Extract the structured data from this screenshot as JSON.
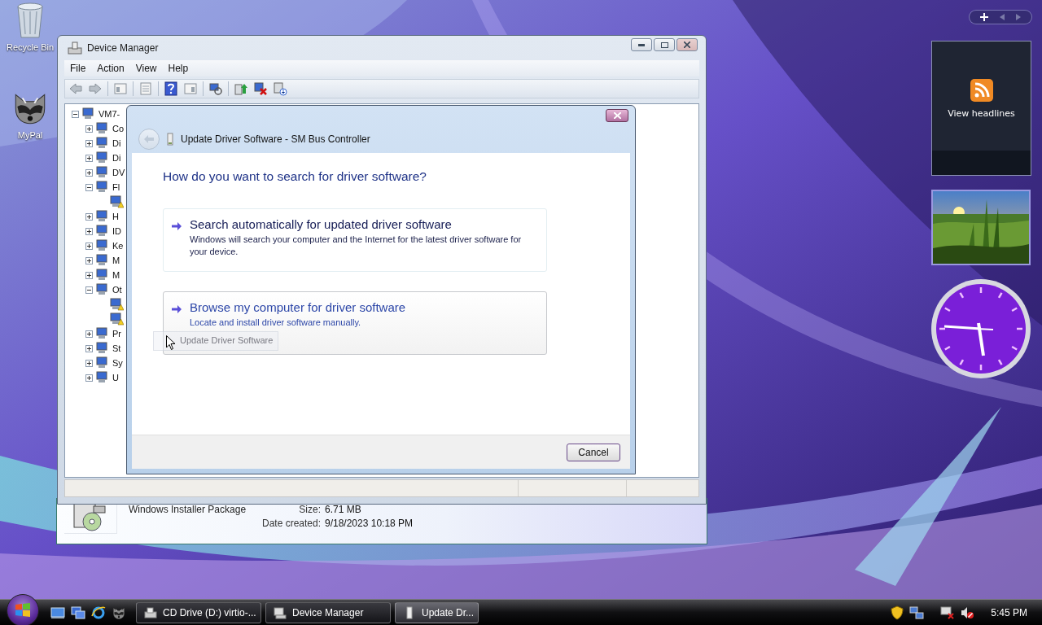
{
  "desktop_icons": [
    {
      "kind": "recycle_bin",
      "label": "Recycle Bin"
    },
    {
      "kind": "mypal",
      "label": "MyPal"
    }
  ],
  "gadgets": {
    "feed": {
      "label": "View headlines"
    }
  },
  "device_manager": {
    "title": "Device Manager",
    "menu": [
      "File",
      "Action",
      "View",
      "Help"
    ],
    "tree": {
      "label": "VM7-",
      "expanded": true,
      "warning": false,
      "children": [
        {
          "label": "Co",
          "expanded": false,
          "warning": false
        },
        {
          "label": "Di",
          "expanded": false,
          "warning": false
        },
        {
          "label": "Di",
          "expanded": false,
          "warning": false
        },
        {
          "label": "DV",
          "expanded": false,
          "warning": false
        },
        {
          "label": "Fl",
          "expanded": true,
          "warning": false,
          "children": [
            {
              "warning": true
            }
          ]
        },
        {
          "label": "H",
          "expanded": false,
          "warning": false
        },
        {
          "label": "ID",
          "expanded": false,
          "warning": false
        },
        {
          "label": "Ke",
          "expanded": false,
          "warning": false
        },
        {
          "label": "M",
          "expanded": false,
          "warning": false
        },
        {
          "label": "M",
          "expanded": false,
          "warning": false
        },
        {
          "label": "Ot",
          "expanded": true,
          "warning": false,
          "children": [
            {
              "warning": true
            },
            {
              "warning": true
            }
          ]
        },
        {
          "label": "Pr",
          "expanded": false,
          "warning": false
        },
        {
          "label": "St",
          "expanded": false,
          "warning": false
        },
        {
          "label": "Sy",
          "expanded": false,
          "warning": false
        },
        {
          "label": "U",
          "expanded": false,
          "warning": false
        }
      ]
    }
  },
  "explorer_details": {
    "file_type": "Windows Installer Package",
    "fields": [
      {
        "label": "Size:",
        "value": "6.71 MB"
      },
      {
        "label": "Date created:",
        "value": "9/18/2023 10:18 PM"
      }
    ]
  },
  "dialog": {
    "title": "Update Driver Software - SM Bus Controller",
    "heading": "How do you want to search for driver software?",
    "options": [
      {
        "title": "Search automatically for updated driver software",
        "description": "Windows will search your computer and the Internet for the latest driver software for your device.",
        "hovered": false
      },
      {
        "title": "Browse my computer for driver software",
        "description": "Locate and install driver software manually.",
        "hovered": true
      }
    ],
    "buttons": [
      "Cancel"
    ],
    "drag_label": "Update Driver Software"
  },
  "taskbar": {
    "tasks": [
      {
        "label": "CD Drive (D:) virtio-...",
        "selected": false
      },
      {
        "label": "Device Manager",
        "selected": false
      },
      {
        "label": "Update Dr...",
        "selected": true
      }
    ],
    "clock": "5:45 PM"
  }
}
